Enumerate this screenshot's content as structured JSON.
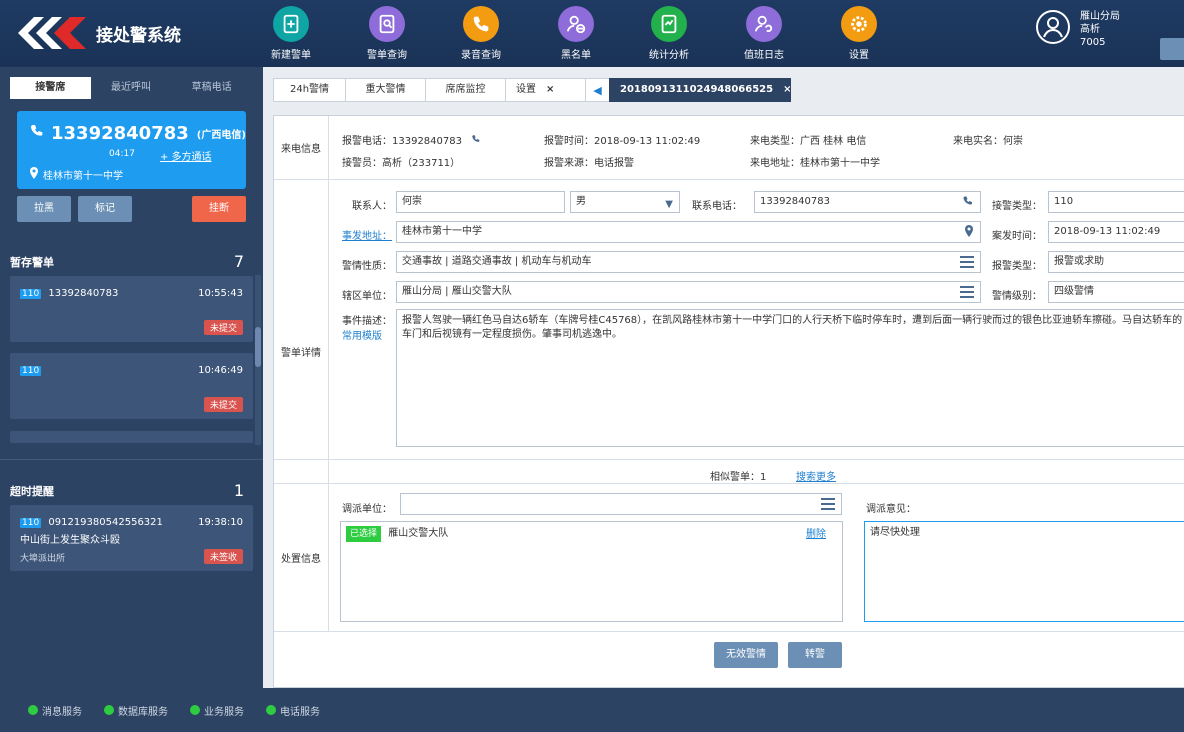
{
  "app": {
    "title": "接处警系统"
  },
  "nav": [
    {
      "label": "新建警单",
      "icon": "new-alarm-icon",
      "color": "#0ea5a4"
    },
    {
      "label": "警单查询",
      "icon": "alarm-query-icon",
      "color": "#8e6cd9"
    },
    {
      "label": "录音查询",
      "icon": "recording-query-icon",
      "color": "#f39c12"
    },
    {
      "label": "黑名单",
      "icon": "blacklist-icon",
      "color": "#8e6cd9"
    },
    {
      "label": "统计分析",
      "icon": "statistics-icon",
      "color": "#22b14c"
    },
    {
      "label": "值班日志",
      "icon": "duty-log-icon",
      "color": "#8e6cd9"
    },
    {
      "label": "设置",
      "icon": "settings-icon",
      "color": "#f39c12"
    }
  ],
  "user": {
    "unit": "雁山分局",
    "name": "高析",
    "id": "7005"
  },
  "left": {
    "tabs": [
      "接警席",
      "最近呼叫",
      "草稿电话"
    ],
    "call": {
      "number": "13392840783",
      "carrier": "(广西电信)",
      "duration": "04:17",
      "multi": "+ 多方通话",
      "location": "桂林市第十一中学"
    },
    "buttons": {
      "pull": "拉黑",
      "mark": "标记",
      "hangup": "挂断"
    },
    "saved": {
      "title": "暂存警单",
      "count": "7",
      "items": [
        {
          "tag": "110",
          "phone": "13392840783",
          "time": "10:55:43",
          "status": "未提交"
        },
        {
          "tag": "110",
          "phone": "",
          "time": "10:46:49",
          "status": "未提交"
        }
      ]
    },
    "overdue": {
      "title": "超时提醒",
      "count": "1",
      "item": {
        "tag": "110",
        "id": "091219380542556321",
        "desc": "中山街上发生聚众斗殴",
        "unit": "大埠派出所",
        "time": "19:38:10",
        "status": "未签收"
      }
    }
  },
  "tabs": [
    {
      "label": "24h警情"
    },
    {
      "label": "重大警情"
    },
    {
      "label": "席席监控"
    },
    {
      "label": "设置",
      "close": "×"
    },
    {
      "label": "2018091311024948066525",
      "close": "×"
    }
  ],
  "call_info": {
    "section": "来电信息",
    "phone_label": "报警电话：",
    "phone": "13392840783",
    "time_label": "报警时间：",
    "time": "2018-09-13 11:02:49",
    "type_label": "来电类型：",
    "type": "广西 桂林 电信",
    "realname_label": "来电实名：",
    "realname": "何崇",
    "operator_label": "接警员：",
    "operator": "高析（233711）",
    "source_label": "报警来源：",
    "source": "电话报警",
    "address_label": "来电地址：",
    "address": "桂林市第十一中学"
  },
  "detail": {
    "section": "警单详情",
    "contact_label": "联系人：",
    "contact": "何崇",
    "gender": "男",
    "contact_phone_label": "联系电话：",
    "contact_phone": "13392840783",
    "receive_type_label": "接警类型：",
    "receive_type": "110",
    "address_label": "事发地址：",
    "address": "桂林市第十一中学",
    "occur_time_label": "案发时间：",
    "occur_time": "2018-09-13 11:02:49",
    "nature_label": "警情性质：",
    "nature": "交通事故 | 道路交通事故 | 机动车与机动车",
    "alarm_type_label": "报警类型：",
    "alarm_type": "报警或求助",
    "unit_label": "辖区单位：",
    "unit": "雁山分局 | 雁山交警大队",
    "level_label": "警情级别：",
    "level": "四级警情",
    "desc_label": "事件描述：",
    "template_link": "常用模版",
    "desc": "报警人驾驶一辆红色马自达6轿车（车牌号桂C45768），在凯风路桂林市第十一中学门口的人行天桥下临时停车时，遭到后面一辆行驶而过的银色比亚迪轿车擦碰。马自达轿车的车门和后视镜有一定程度损伤。肇事司机逃逸中。"
  },
  "similar": {
    "label": "相似警单：",
    "count": "1",
    "more": "搜索更多"
  },
  "dispatch": {
    "section": "处置信息",
    "unit_label": "调派单位：",
    "opinion_label": "调派意见：",
    "selected_tag": "已选择",
    "selected_unit": "雁山交警大队",
    "remove": "删除",
    "opinion": "请尽快处理"
  },
  "actions": {
    "invalid": "无效警情",
    "transfer": "转警"
  },
  "services": [
    "消息服务",
    "数据库服务",
    "业务服务",
    "电话服务"
  ]
}
